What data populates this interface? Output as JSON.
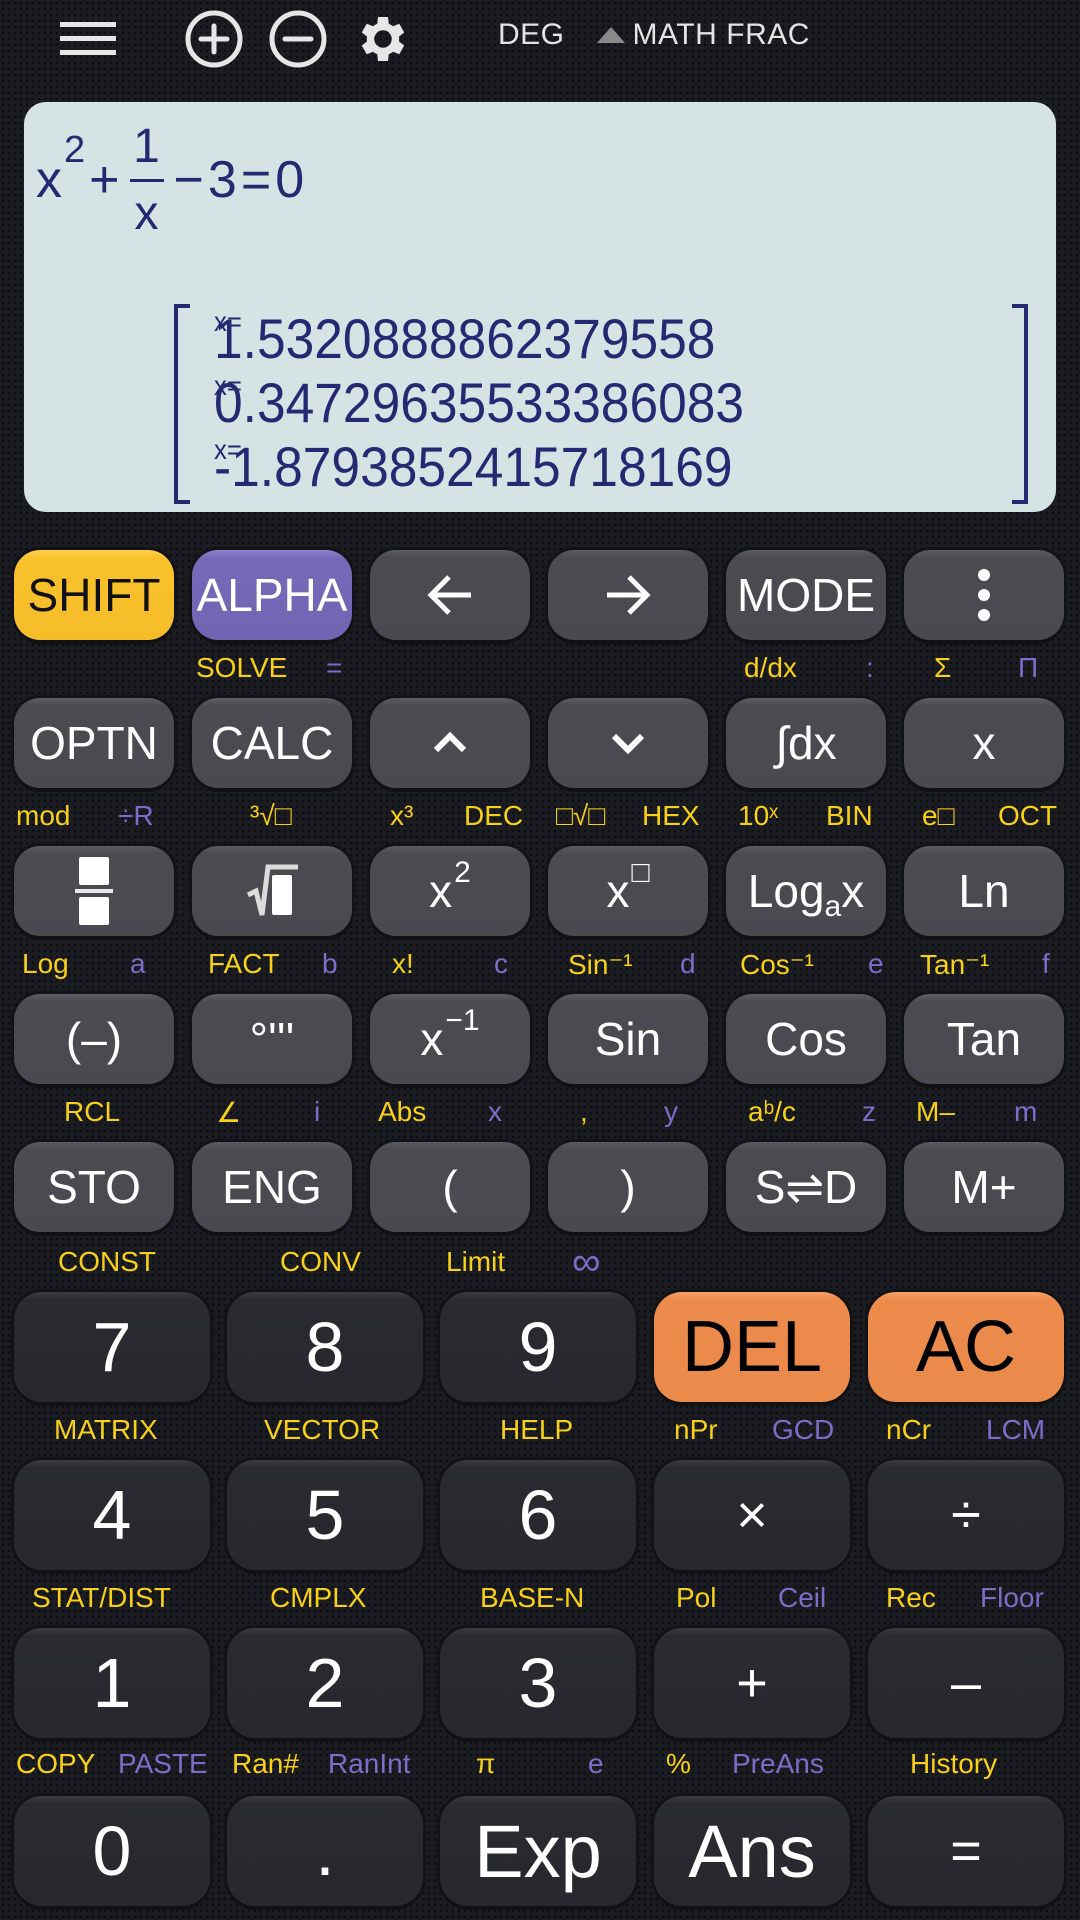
{
  "topbar": {
    "icons": [
      "menu-icon",
      "zoom-in-icon",
      "zoom-out-icon",
      "settings-icon"
    ],
    "status": {
      "angle": "DEG",
      "indicator": "shift-indicator-triangle",
      "mode": "MATH",
      "format": "FRAC"
    }
  },
  "display": {
    "equation": {
      "base": "x",
      "exponent": "2",
      "plus": "+",
      "numerator": "1",
      "denominator": "x",
      "minus": "−",
      "constant": "3",
      "equals": "=",
      "rhs": "0"
    },
    "results": [
      {
        "label": "x=",
        "value": "1.5320888862379558"
      },
      {
        "label": "x=",
        "value": "0.34729635533386083"
      },
      {
        "label": "x=",
        "value": "-1.8793852415718169"
      }
    ]
  },
  "keys": {
    "row1": [
      {
        "label": "SHIFT"
      },
      {
        "label": "ALPHA"
      },
      {
        "label": "←"
      },
      {
        "label": "→"
      },
      {
        "label": "MODE"
      },
      {
        "label": "⋮"
      }
    ],
    "row1_sub": [
      {
        "text": "SOLVE",
        "color": "yellow"
      },
      {
        "text": "=",
        "color": "purple"
      },
      {
        "text": "d/dx",
        "color": "yellow"
      },
      {
        "text": ":",
        "color": "purple"
      },
      {
        "text": "Σ",
        "color": "yellow"
      },
      {
        "text": "Π",
        "color": "purple"
      }
    ],
    "row2": [
      {
        "label": "OPTN"
      },
      {
        "label": "CALC"
      },
      {
        "label": "^"
      },
      {
        "label": "v"
      },
      {
        "label": "∫dx"
      },
      {
        "label": "x"
      }
    ],
    "row2_sub": [
      {
        "text": "mod",
        "color": "yellow"
      },
      {
        "text": "÷R",
        "color": "purple"
      },
      {
        "text": "³√□",
        "color": "yellow"
      },
      {
        "text": "x³",
        "color": "yellow"
      },
      {
        "text": "DEC",
        "color": "yellow"
      },
      {
        "text": "□√□",
        "color": "yellow"
      },
      {
        "text": "HEX",
        "color": "yellow"
      },
      {
        "text": "10ˣ",
        "color": "yellow"
      },
      {
        "text": "BIN",
        "color": "yellow"
      },
      {
        "text": "e□",
        "color": "yellow"
      },
      {
        "text": "OCT",
        "color": "yellow"
      }
    ],
    "row3": [
      {
        "label": "fraction"
      },
      {
        "label": "sqrt"
      },
      {
        "label": "x",
        "sup": "2"
      },
      {
        "label": "x",
        "sup": "□"
      },
      {
        "label": "Log",
        "sub": "a",
        "after": "x"
      },
      {
        "label": "Ln"
      }
    ],
    "row3_sub": [
      {
        "text": "Log",
        "color": "yellow"
      },
      {
        "text": "a",
        "color": "purple"
      },
      {
        "text": "FACT",
        "color": "yellow"
      },
      {
        "text": "b",
        "color": "purple"
      },
      {
        "text": "x!",
        "color": "yellow"
      },
      {
        "text": "c",
        "color": "purple"
      },
      {
        "text": "Sin⁻¹",
        "color": "yellow"
      },
      {
        "text": "d",
        "color": "purple"
      },
      {
        "text": "Cos⁻¹",
        "color": "yellow"
      },
      {
        "text": "e",
        "color": "purple"
      },
      {
        "text": "Tan⁻¹",
        "color": "yellow"
      },
      {
        "text": "f",
        "color": "purple"
      }
    ],
    "row4": [
      {
        "label": "(–)"
      },
      {
        "label": "°'''"
      },
      {
        "label": "x",
        "sup": "−1"
      },
      {
        "label": "Sin"
      },
      {
        "label": "Cos"
      },
      {
        "label": "Tan"
      }
    ],
    "row4_sub": [
      {
        "text": "RCL",
        "color": "yellow"
      },
      {
        "text": "∠",
        "color": "yellow"
      },
      {
        "text": "i",
        "color": "purple"
      },
      {
        "text": "Abs",
        "color": "yellow"
      },
      {
        "text": "x",
        "color": "purple"
      },
      {
        "text": ",",
        "color": "yellow"
      },
      {
        "text": "y",
        "color": "purple"
      },
      {
        "text": "aᵇ/c",
        "color": "yellow"
      },
      {
        "text": "z",
        "color": "purple"
      },
      {
        "text": "M–",
        "color": "yellow"
      },
      {
        "text": "m",
        "color": "purple"
      }
    ],
    "row5": [
      {
        "label": "STO"
      },
      {
        "label": "ENG"
      },
      {
        "label": "("
      },
      {
        "label": ")"
      },
      {
        "label": "S⇌D"
      },
      {
        "label": "M+"
      }
    ],
    "row5_sub": [
      {
        "text": "CONST",
        "color": "yellow"
      },
      {
        "text": "CONV",
        "color": "yellow"
      },
      {
        "text": "Limit",
        "color": "yellow"
      },
      {
        "text": "∞",
        "color": "purple"
      }
    ],
    "row6": [
      {
        "label": "7"
      },
      {
        "label": "8"
      },
      {
        "label": "9"
      },
      {
        "label": "DEL"
      },
      {
        "label": "AC"
      }
    ],
    "row6_sub": [
      {
        "text": "MATRIX",
        "color": "yellow"
      },
      {
        "text": "VECTOR",
        "color": "yellow"
      },
      {
        "text": "HELP",
        "color": "yellow"
      },
      {
        "text": "nPr",
        "color": "yellow"
      },
      {
        "text": "GCD",
        "color": "purple"
      },
      {
        "text": "nCr",
        "color": "yellow"
      },
      {
        "text": "LCM",
        "color": "purple"
      }
    ],
    "row7": [
      {
        "label": "4"
      },
      {
        "label": "5"
      },
      {
        "label": "6"
      },
      {
        "label": "×"
      },
      {
        "label": "÷"
      }
    ],
    "row7_sub": [
      {
        "text": "STAT/DIST",
        "color": "yellow"
      },
      {
        "text": "CMPLX",
        "color": "yellow"
      },
      {
        "text": "BASE-N",
        "color": "yellow"
      },
      {
        "text": "Pol",
        "color": "yellow"
      },
      {
        "text": "Ceil",
        "color": "purple"
      },
      {
        "text": "Rec",
        "color": "yellow"
      },
      {
        "text": "Floor",
        "color": "purple"
      }
    ],
    "row8": [
      {
        "label": "1"
      },
      {
        "label": "2"
      },
      {
        "label": "3"
      },
      {
        "label": "+"
      },
      {
        "label": "–"
      }
    ],
    "row8_sub": [
      {
        "text": "COPY",
        "color": "yellow"
      },
      {
        "text": "PASTE",
        "color": "purple"
      },
      {
        "text": "Ran#",
        "color": "yellow"
      },
      {
        "text": "RanInt",
        "color": "purple"
      },
      {
        "text": "π",
        "color": "yellow"
      },
      {
        "text": "e",
        "color": "purple"
      },
      {
        "text": "%",
        "color": "yellow"
      },
      {
        "text": "PreAns",
        "color": "purple"
      },
      {
        "text": "History",
        "color": "yellow"
      }
    ],
    "row9": [
      {
        "label": "0"
      },
      {
        "label": "."
      },
      {
        "label": "Exp"
      },
      {
        "label": "Ans"
      },
      {
        "label": "="
      }
    ]
  },
  "colors": {
    "shift": "#f5bd29",
    "alpha": "#7264b2",
    "orange": "#ea8a4b",
    "yellow_text": "#f7d117",
    "purple_text": "#7b6ec9",
    "display_bg": "#d6e3e4",
    "display_text": "#232a72"
  }
}
